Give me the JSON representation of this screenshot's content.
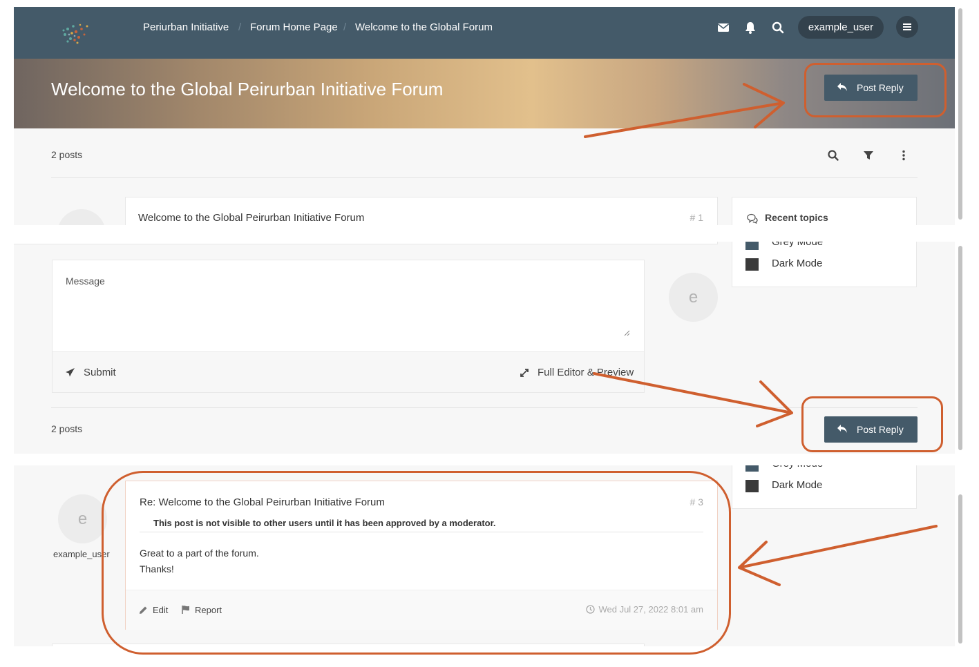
{
  "nav": {
    "breadcrumbs": [
      "Periurban Initiative",
      "Forum Home Page",
      "Welcome to the Global Forum"
    ],
    "username": "example_user"
  },
  "hero": {
    "title": "Welcome to the Global Peirurban Initiative Forum"
  },
  "actions": {
    "post_reply": "Post Reply"
  },
  "topic": {
    "post_count": "2 posts",
    "first_post_title": "Welcome to the Global Peirurban Initiative Forum",
    "first_post_number": "# 1"
  },
  "sidebar": {
    "recent_topics": "Recent topics",
    "grey_mode": "Grey Mode",
    "dark_mode": "Dark Mode"
  },
  "quick_reply": {
    "placeholder": "Message",
    "submit": "Submit",
    "full_editor": "Full Editor & Preview",
    "avatar_letter": "e"
  },
  "new_post": {
    "title": "Re: Welcome to the Global Peirurban Initiative Forum",
    "number": "# 3",
    "notice": "This post is not visible to other users until it has been approved by a moderator.",
    "body_lines": [
      "Great to a part of the forum.",
      "Thanks!"
    ],
    "edit": "Edit",
    "report": "Report",
    "timestamp": "Wed Jul 27, 2022 8:01 am",
    "author": "example_user",
    "avatar_letter": "e"
  },
  "colors": {
    "navbar": "#445a69",
    "button": "#445a69",
    "pill": "#33424d",
    "annotation": "#cf5f2f",
    "grey_swatch": "#445a69",
    "dark_swatch": "#3a3a3a"
  }
}
